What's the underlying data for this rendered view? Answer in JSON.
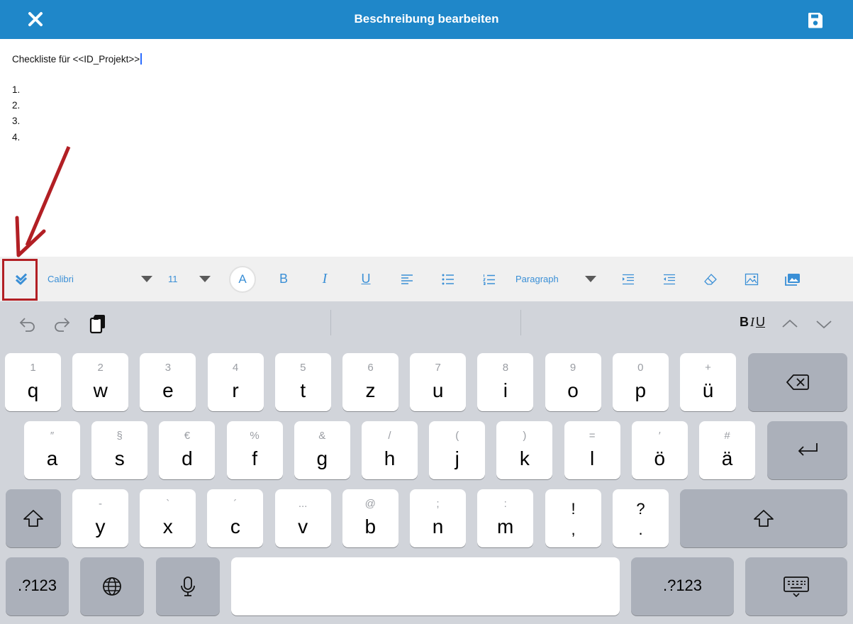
{
  "header": {
    "title": "Beschreibung bearbeiten",
    "close_icon": "close-icon",
    "save_icon": "save-icon",
    "color": "#1f87c9"
  },
  "editor": {
    "first_line": "Checkliste für <<ID_Projekt>>",
    "list_items": [
      "1.",
      "2.",
      "3.",
      "4."
    ]
  },
  "toolbar": {
    "font": "Calibri",
    "size": "11",
    "font_color_label": "A",
    "bold": "B",
    "italic": "I",
    "underline": "U",
    "block_format": "Paragraph"
  },
  "keyboard": {
    "format_bold": "B",
    "format_italic": "I",
    "format_underline": "U",
    "row1": [
      {
        "pri": "q",
        "sec": "1"
      },
      {
        "pri": "w",
        "sec": "2"
      },
      {
        "pri": "e",
        "sec": "3"
      },
      {
        "pri": "r",
        "sec": "4"
      },
      {
        "pri": "t",
        "sec": "5"
      },
      {
        "pri": "z",
        "sec": "6"
      },
      {
        "pri": "u",
        "sec": "7"
      },
      {
        "pri": "i",
        "sec": "8"
      },
      {
        "pri": "o",
        "sec": "9"
      },
      {
        "pri": "p",
        "sec": "0"
      },
      {
        "pri": "ü",
        "sec": "+"
      }
    ],
    "row2": [
      {
        "pri": "a",
        "sec": "″"
      },
      {
        "pri": "s",
        "sec": "§"
      },
      {
        "pri": "d",
        "sec": "€"
      },
      {
        "pri": "f",
        "sec": "%"
      },
      {
        "pri": "g",
        "sec": "&"
      },
      {
        "pri": "h",
        "sec": "/"
      },
      {
        "pri": "j",
        "sec": "("
      },
      {
        "pri": "k",
        "sec": ")"
      },
      {
        "pri": "l",
        "sec": "="
      },
      {
        "pri": "ö",
        "sec": "′"
      },
      {
        "pri": "ä",
        "sec": "#"
      }
    ],
    "row3": [
      {
        "pri": "y",
        "sec": "-"
      },
      {
        "pri": "x",
        "sec": "`"
      },
      {
        "pri": "c",
        "sec": "´"
      },
      {
        "pri": "v",
        "sec": "..."
      },
      {
        "pri": "b",
        "sec": "@"
      },
      {
        "pri": "n",
        "sec": ";"
      },
      {
        "pri": "m",
        "sec": ":"
      }
    ],
    "punct": [
      {
        "top": "!",
        "bottom": ","
      },
      {
        "top": "?",
        "bottom": "."
      }
    ],
    "numbers_key": ".?123"
  }
}
